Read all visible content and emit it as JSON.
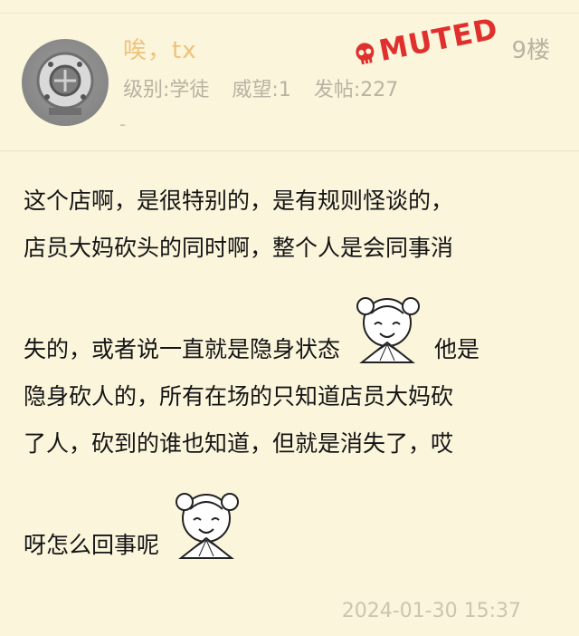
{
  "header": {
    "username": "唉，tx",
    "level": "级别:学徒",
    "prestige": "威望:1",
    "posts": "发帖:227",
    "dash": "-",
    "floor": "9楼",
    "stamp_text": "MUTED",
    "colors": {
      "username": "#efc27a",
      "stamp": "#e0302d",
      "background": "#fbf5dc"
    }
  },
  "post": {
    "line1": "这个店啊，是很特别的，是有规则怪谈的，",
    "line2": "店员大妈砍头的同时啊，整个人是会同事消",
    "line3_a": "失的，或者说一直就是隐身状态",
    "line3_b": "他是",
    "line4": "隐身砍人的，所有在场的只知道店员大妈砍",
    "line5": "了人，砍到的谁也知道，但就是消失了，哎",
    "line6": "呀怎么回事呢",
    "emote_icon": "laughing-girl-emote-icon"
  },
  "timestamp": "2024-01-30 15:37"
}
